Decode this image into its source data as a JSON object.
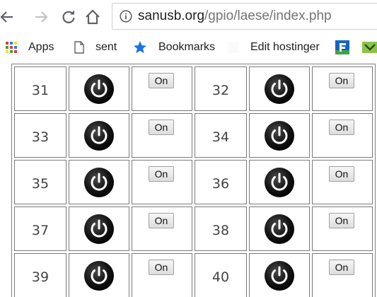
{
  "browser": {
    "url_host": "sanusb.org",
    "url_path": "/gpio/laese/index.php",
    "buttons": {
      "back": "back-arrow",
      "forward": "forward-arrow",
      "reload": "reload",
      "home": "home",
      "info": "info"
    }
  },
  "bookmarks": [
    {
      "label": "Apps",
      "icon": "apps-grid-icon"
    },
    {
      "label": "sent",
      "icon": "page-icon"
    },
    {
      "label": "Bookmarks",
      "icon": "star-icon"
    },
    {
      "label": "Edit hostinger",
      "icon": "blank-favicon"
    },
    {
      "label": "",
      "icon": "f-favicon"
    },
    {
      "label": "",
      "icon": "green-favicon"
    }
  ],
  "colors": {
    "accent_blue": "#1a73e8",
    "apps_red": "#e53935",
    "apps_green": "#43a047",
    "apps_blue": "#1e88e5",
    "apps_yellow": "#fdd835",
    "border": "#7a7a7a"
  },
  "gpio_rows": [
    [
      {
        "pin": "31",
        "button": "On"
      },
      {
        "pin": "32",
        "button": "On"
      }
    ],
    [
      {
        "pin": "33",
        "button": "On"
      },
      {
        "pin": "34",
        "button": "On"
      }
    ],
    [
      {
        "pin": "35",
        "button": "On"
      },
      {
        "pin": "36",
        "button": "On"
      }
    ],
    [
      {
        "pin": "37",
        "button": "On"
      },
      {
        "pin": "38",
        "button": "On"
      }
    ],
    [
      {
        "pin": "39",
        "button": "On"
      },
      {
        "pin": "40",
        "button": "On"
      }
    ]
  ]
}
